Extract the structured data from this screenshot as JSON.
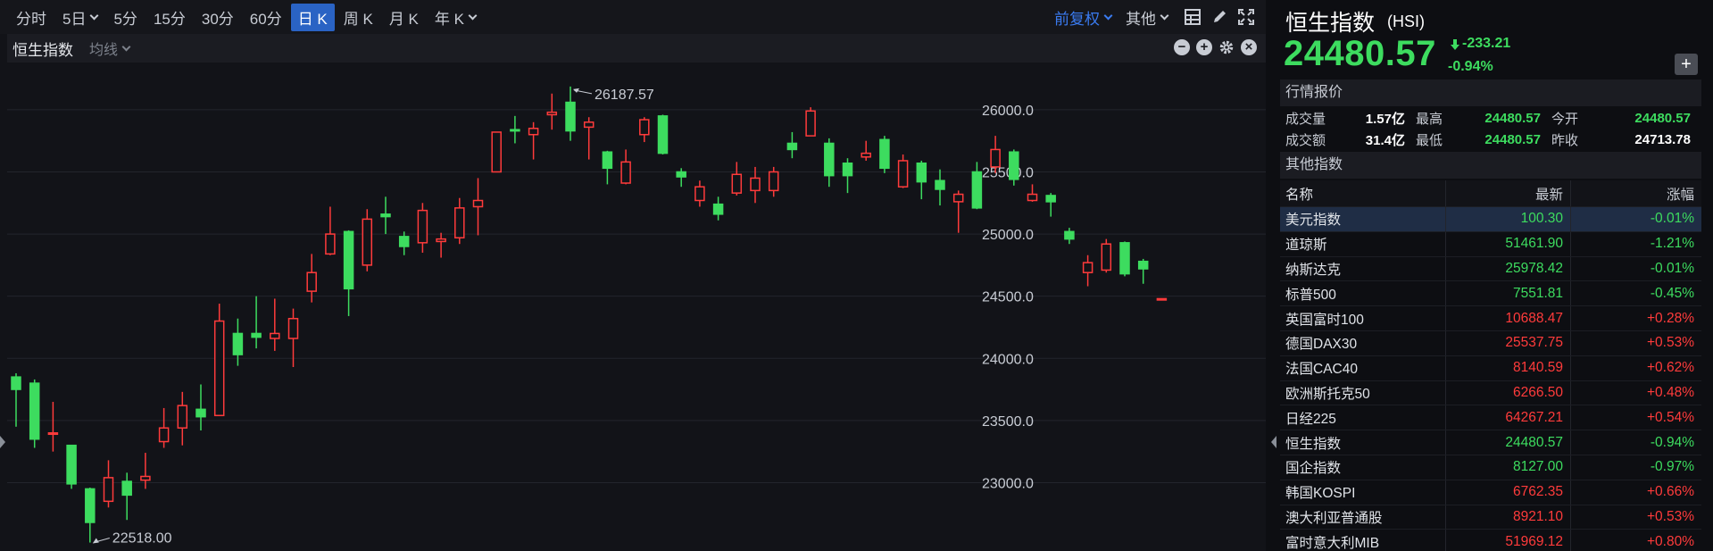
{
  "toolbar": {
    "timeframes": [
      "分时",
      "5日",
      "5分",
      "15分",
      "30分",
      "60分",
      "日 K",
      "周 K",
      "月 K",
      "年 K"
    ],
    "active_timeframe": "日 K",
    "adjust_label": "前复权",
    "other_label": "其他"
  },
  "subbar": {
    "title": "恒生指数",
    "ma_label": "均线"
  },
  "quote": {
    "name": "恒生指数",
    "code": "(HSI)",
    "price": "24480.57",
    "change": "-233.21",
    "change_pct": "-0.94%",
    "section_title": "行情报价",
    "stats": {
      "volume_label": "成交量",
      "volume": "1.57亿",
      "high_label": "最高",
      "high": "24480.57",
      "open_label": "今开",
      "open": "24480.57",
      "amount_label": "成交额",
      "amount": "31.4亿",
      "low_label": "最低",
      "low": "24480.57",
      "prev_close_label": "昨收",
      "prev_close": "24713.78"
    }
  },
  "other_indices": {
    "section_title": "其他指数",
    "headers": [
      "名称",
      "最新",
      "涨幅"
    ],
    "rows": [
      {
        "name": "美元指数",
        "last": "100.30",
        "chg": "-0.01%",
        "dir": "dn"
      },
      {
        "name": "道琼斯",
        "last": "51461.90",
        "chg": "-1.21%",
        "dir": "dn"
      },
      {
        "name": "纳斯达克",
        "last": "25978.42",
        "chg": "-0.01%",
        "dir": "dn"
      },
      {
        "name": "标普500",
        "last": "7551.81",
        "chg": "-0.45%",
        "dir": "dn"
      },
      {
        "name": "英国富时100",
        "last": "10688.47",
        "chg": "+0.28%",
        "dir": "up"
      },
      {
        "name": "德国DAX30",
        "last": "25537.75",
        "chg": "+0.53%",
        "dir": "up"
      },
      {
        "name": "法国CAC40",
        "last": "8140.59",
        "chg": "+0.62%",
        "dir": "up"
      },
      {
        "name": "欧洲斯托克50",
        "last": "6266.50",
        "chg": "+0.48%",
        "dir": "up"
      },
      {
        "name": "日经225",
        "last": "64267.21",
        "chg": "+0.54%",
        "dir": "up"
      },
      {
        "name": "恒生指数",
        "last": "24480.57",
        "chg": "-0.94%",
        "dir": "dn"
      },
      {
        "name": "国企指数",
        "last": "8127.00",
        "chg": "-0.97%",
        "dir": "dn"
      },
      {
        "name": "韩国KOSPI",
        "last": "6762.35",
        "chg": "+0.66%",
        "dir": "up"
      },
      {
        "name": "澳大利亚普通股",
        "last": "8921.10",
        "chg": "+0.53%",
        "dir": "up"
      },
      {
        "name": "富时意大利MIB",
        "last": "51969.12",
        "chg": "+0.80%",
        "dir": "up"
      }
    ]
  },
  "colors": {
    "up": "#ff3b3b",
    "down": "#3ddc5f",
    "accent": "#2a63c4"
  },
  "chart_data": {
    "type": "candlestick",
    "y_ticks": [
      "26000.0",
      "25500.0",
      "25000.0",
      "24500.0",
      "24000.0",
      "23500.0",
      "23000.0"
    ],
    "ylim": [
      22450,
      26380
    ],
    "high_annotation": "26187.57",
    "low_annotation": "22518.00",
    "candles": [
      [
        23850,
        23750,
        23880,
        23450
      ],
      [
        23800,
        23350,
        23830,
        23280
      ],
      [
        23400,
        23400,
        23650,
        23250
      ],
      [
        23300,
        22990,
        23300,
        22950
      ],
      [
        22950,
        22680,
        22960,
        22518
      ],
      [
        22850,
        23040,
        23180,
        22800
      ],
      [
        23010,
        22900,
        23080,
        22700
      ],
      [
        23020,
        23050,
        23240,
        22950
      ],
      [
        23330,
        23440,
        23600,
        23280
      ],
      [
        23440,
        23620,
        23730,
        23300
      ],
      [
        23590,
        23530,
        23790,
        23420
      ],
      [
        23540,
        24300,
        24440,
        23540
      ],
      [
        24200,
        24030,
        24320,
        23940
      ],
      [
        24200,
        24170,
        24500,
        24080
      ],
      [
        24160,
        24200,
        24480,
        24060
      ],
      [
        24160,
        24320,
        24400,
        23930
      ],
      [
        24540,
        24690,
        24840,
        24450
      ],
      [
        24840,
        25000,
        25220,
        24830
      ],
      [
        25020,
        24560,
        25030,
        24340
      ],
      [
        24750,
        25120,
        25200,
        24700
      ],
      [
        25160,
        25140,
        25300,
        25000
      ],
      [
        24980,
        24900,
        25020,
        24830
      ],
      [
        24930,
        25190,
        25250,
        24850
      ],
      [
        24940,
        24960,
        25010,
        24810
      ],
      [
        24970,
        25210,
        25290,
        24920
      ],
      [
        25220,
        25270,
        25450,
        24990
      ],
      [
        25500,
        25820,
        25820,
        25500
      ],
      [
        25840,
        25830,
        25950,
        25730
      ],
      [
        25800,
        25850,
        25900,
        25600
      ],
      [
        25960,
        25980,
        26130,
        25840
      ],
      [
        26060,
        25830,
        26187,
        25750
      ],
      [
        25860,
        25900,
        25940,
        25600
      ],
      [
        25660,
        25530,
        25670,
        25400
      ],
      [
        25410,
        25580,
        25680,
        25400
      ],
      [
        25800,
        25920,
        25940,
        25740
      ],
      [
        25950,
        25650,
        25960,
        25640
      ],
      [
        25500,
        25460,
        25530,
        25380
      ],
      [
        25270,
        25380,
        25430,
        25220
      ],
      [
        25240,
        25160,
        25300,
        25110
      ],
      [
        25330,
        25480,
        25580,
        25310
      ],
      [
        25350,
        25450,
        25540,
        25250
      ],
      [
        25350,
        25500,
        25540,
        25300
      ],
      [
        25730,
        25680,
        25820,
        25610
      ],
      [
        25790,
        25990,
        26020,
        25790
      ],
      [
        25730,
        25470,
        25770,
        25380
      ],
      [
        25570,
        25470,
        25610,
        25330
      ],
      [
        25620,
        25650,
        25750,
        25590
      ],
      [
        25760,
        25530,
        25790,
        25490
      ],
      [
        25380,
        25590,
        25640,
        25370
      ],
      [
        25570,
        25420,
        25590,
        25280
      ],
      [
        25430,
        25360,
        25520,
        25230
      ],
      [
        25260,
        25320,
        25350,
        25010
      ],
      [
        25500,
        25210,
        25580,
        25200
      ],
      [
        25540,
        25680,
        25790,
        25490
      ],
      [
        25660,
        25440,
        25680,
        25390
      ],
      [
        25270,
        25320,
        25400,
        25260
      ],
      [
        25310,
        25260,
        25330,
        25140
      ],
      [
        25020,
        24960,
        25050,
        24920
      ],
      [
        24690,
        24770,
        24830,
        24580
      ],
      [
        24710,
        24920,
        24960,
        24690
      ],
      [
        24930,
        24680,
        24940,
        24660
      ],
      [
        24780,
        24720,
        24800,
        24600
      ],
      [
        24480,
        24480,
        24480,
        24480
      ]
    ]
  }
}
